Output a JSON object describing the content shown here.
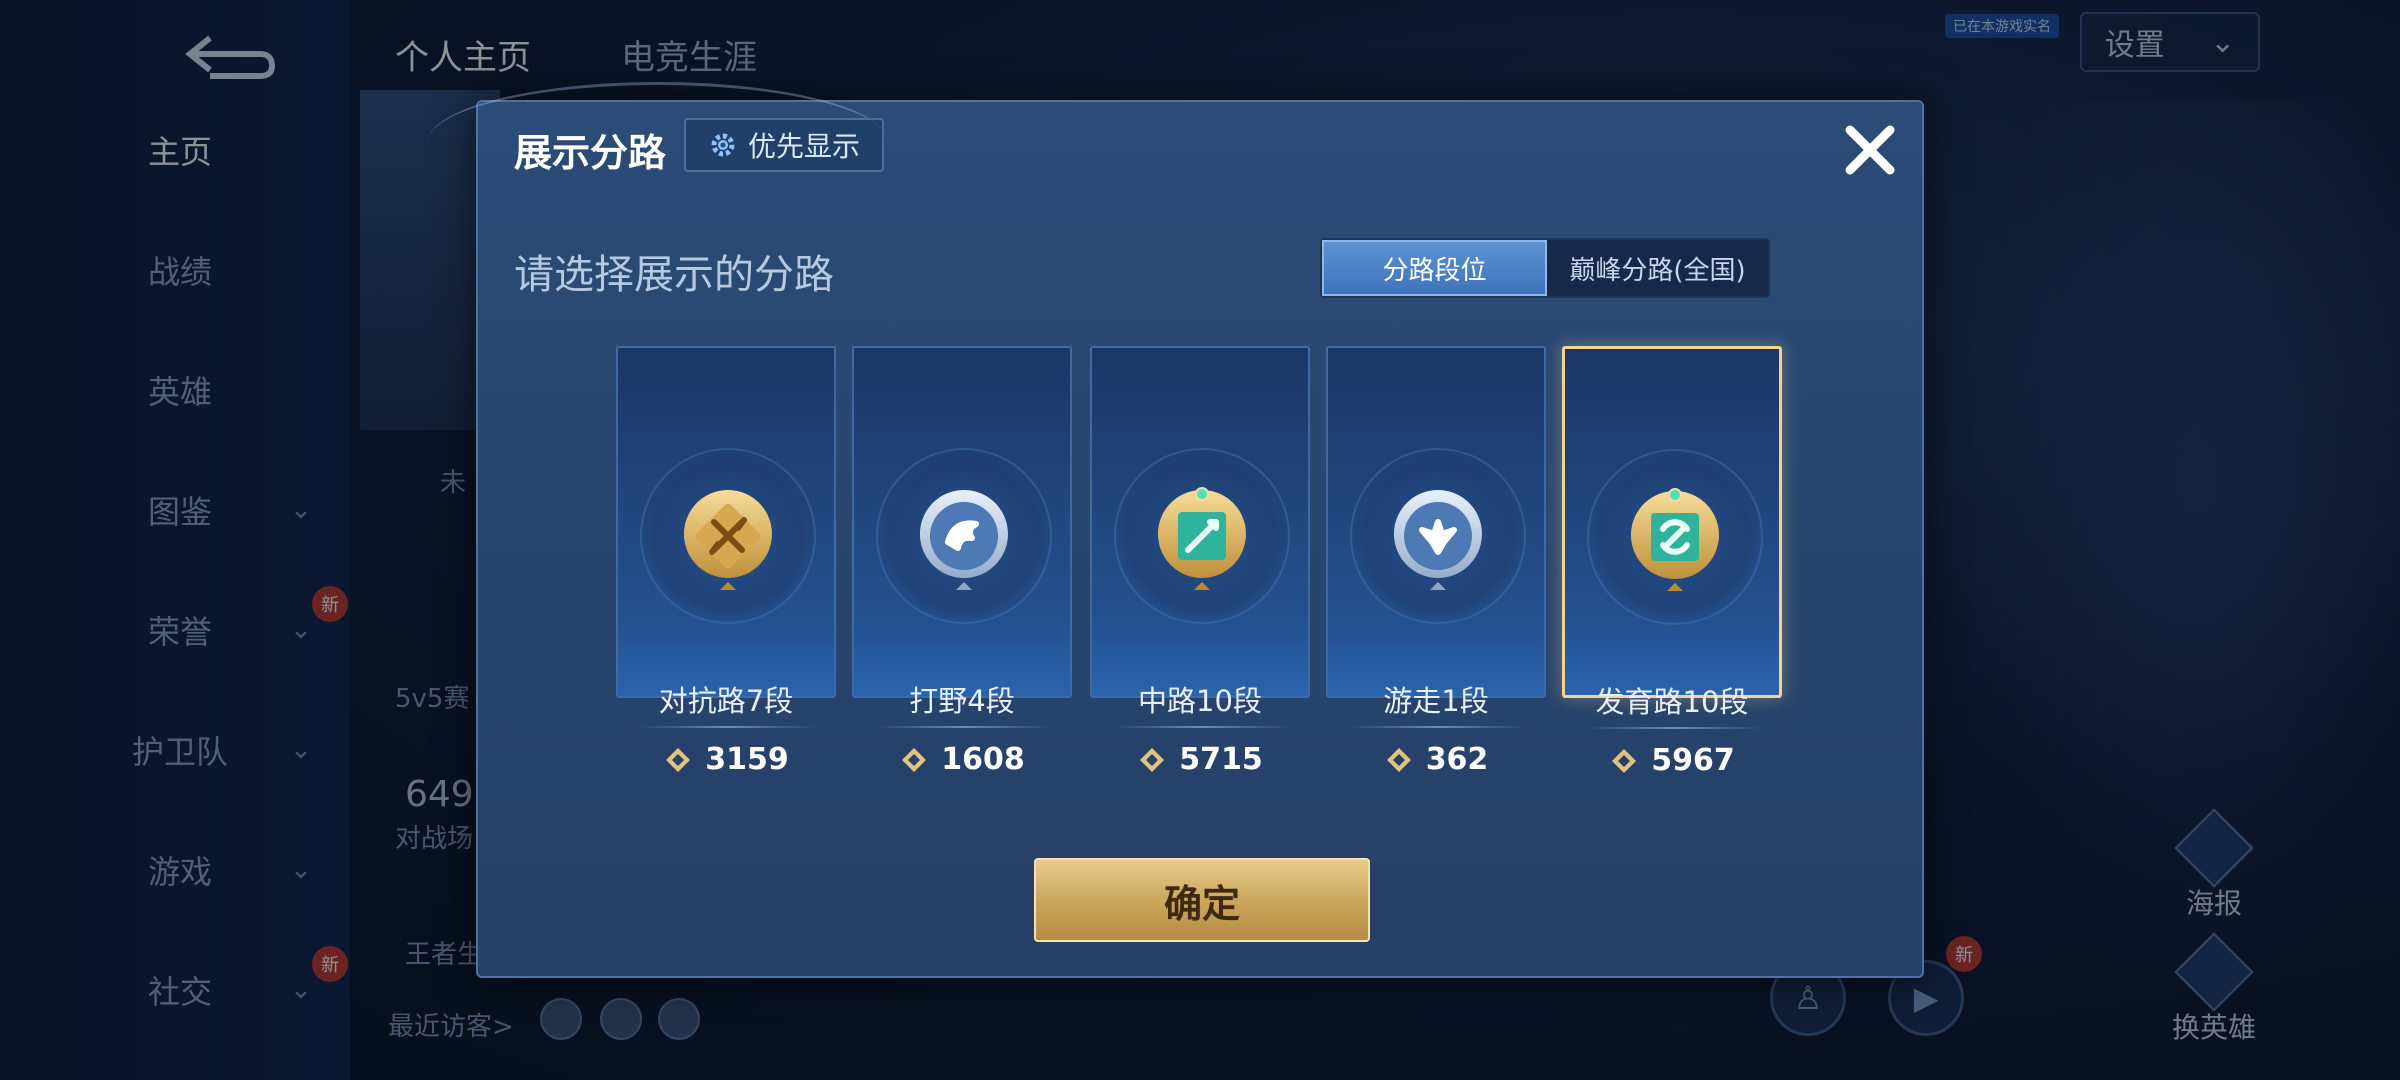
{
  "background": {
    "nav_items": [
      {
        "label": "主页",
        "chevron": false,
        "new": false
      },
      {
        "label": "战绩",
        "chevron": false,
        "new": false
      },
      {
        "label": "英雄",
        "chevron": false,
        "new": false
      },
      {
        "label": "图鉴",
        "chevron": true,
        "new": false
      },
      {
        "label": "荣誉",
        "chevron": true,
        "new": true
      },
      {
        "label": "护卫队",
        "chevron": true,
        "new": false
      },
      {
        "label": "游戏",
        "chevron": true,
        "new": false
      },
      {
        "label": "社交",
        "chevron": true,
        "new": true
      }
    ],
    "new_badge": "新",
    "top_tabs": [
      "个人主页",
      "电竞生涯"
    ],
    "settings_label": "设置",
    "verified_tag": "已在本游戏实名",
    "partial_texts": {
      "status_partial": "未",
      "mode_partial": "5v5赛",
      "stat_number_partial": "649",
      "stat_label_partial": "对战场",
      "honor_partial": "王者生"
    },
    "recent_visitors_label": "最近访客>",
    "side_buttons": [
      {
        "label": "海报",
        "icon": "poster-icon"
      },
      {
        "label": "换英雄",
        "icon": "swap-hero-icon"
      }
    ]
  },
  "modal": {
    "title": "展示分路",
    "priority_button": "优先显示",
    "subtitle": "请选择展示的分路",
    "segment": {
      "options": [
        "分路段位",
        "巅峰分路(全国)"
      ],
      "active_index": 0
    },
    "lanes": [
      {
        "name": "对抗路7段",
        "score": "3159",
        "icon": "clash-lane-icon",
        "badge": "gold",
        "selected": false
      },
      {
        "name": "打野4段",
        "score": "1608",
        "icon": "jungle-icon",
        "badge": "silver",
        "selected": false
      },
      {
        "name": "中路10段",
        "score": "5715",
        "icon": "mid-lane-icon",
        "badge": "gold-jade",
        "selected": false
      },
      {
        "name": "游走1段",
        "score": "362",
        "icon": "roam-icon",
        "badge": "silver",
        "selected": false
      },
      {
        "name": "发育路10段",
        "score": "5967",
        "icon": "farm-lane-icon",
        "badge": "gold-jade",
        "selected": true
      }
    ],
    "confirm_label": "确定"
  },
  "colors": {
    "accent_blue": "#3f74b8",
    "gold": "#c9a45a",
    "selected_border": "#f2d390"
  }
}
